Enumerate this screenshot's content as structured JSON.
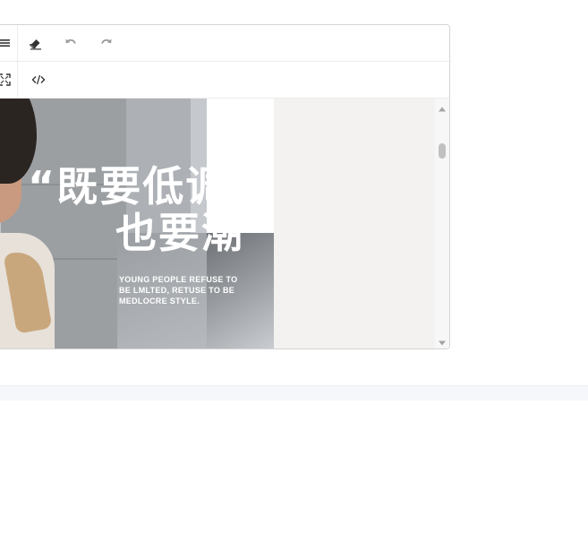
{
  "toolbar": {
    "row1": [
      {
        "icon": "list-icon",
        "title": "List"
      },
      {
        "icon": "eraser-icon",
        "title": "Clear Formatting"
      },
      {
        "icon": "undo-icon",
        "title": "Undo"
      },
      {
        "icon": "redo-icon",
        "title": "Redo"
      }
    ],
    "row2": [
      {
        "icon": "fullscreen-icon",
        "title": "Fullscreen"
      },
      {
        "icon": "code-view-icon",
        "title": "Code View"
      }
    ]
  },
  "banner": {
    "headline_line1": "“既要低调",
    "headline_line2": "也要潮”",
    "subtitle": "YOUNG PEOPLE REFUSE TO BE LMLTED, RETUSE TO BE MEDLOCRE STYLE."
  },
  "colors": {
    "border": "#d4d4d4",
    "toolbar_icon": "#333333",
    "disabled_icon": "#9a9a9a",
    "content_bg": "#f3f2f0"
  }
}
